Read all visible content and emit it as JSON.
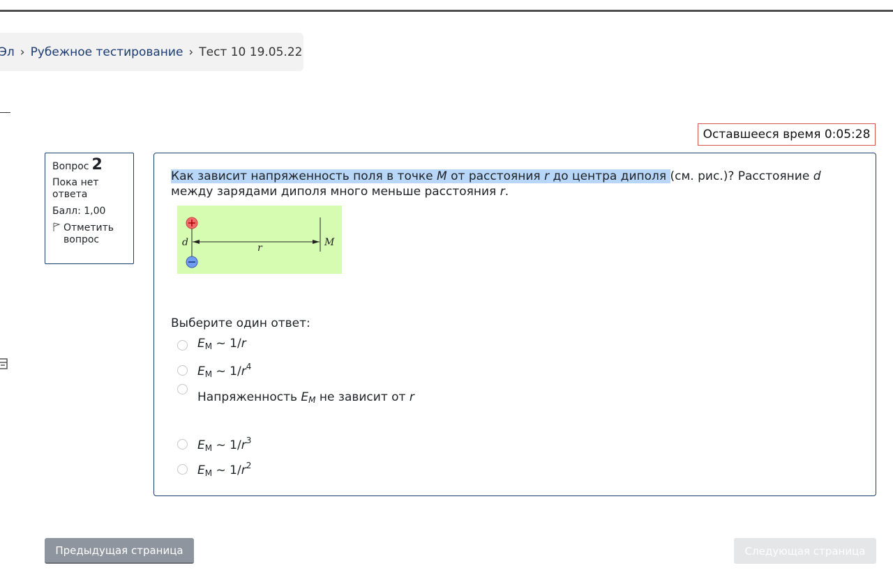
{
  "breadcrumb": {
    "items": [
      "Эл",
      "Рубежное тестирование",
      "Тест 10 19.05.22"
    ]
  },
  "timer": {
    "label": "Оставшееся время",
    "value": "0:05:28"
  },
  "question_info": {
    "label": "Вопрос",
    "number": "2",
    "state": "Пока нет ответа",
    "grade": "Балл: 1,00",
    "flag": "Отметить вопрос"
  },
  "question": {
    "text_part1": "Как зависит напряженность поля в точке ",
    "text_M": "M",
    "text_part2": " от расстояния ",
    "text_r": "r",
    "text_part3": " до центра диполя ",
    "text_part4": "(см. рис.)? Расстояние ",
    "text_d": "d",
    "text_part5": " между зарядами диполя много меньше расстояния ",
    "text_r2": "r",
    "text_end": ".",
    "figure": {
      "d": "d",
      "r": "r",
      "M": "M"
    }
  },
  "prompt": "Выберите один ответ:",
  "answers": [
    {
      "E": "E",
      "sub": "M",
      "rel": " ~ 1/",
      "r": "r",
      "sup": ""
    },
    {
      "E": "E",
      "sub": "M",
      "rel": " ~ 1/",
      "r": "r",
      "sup": "4"
    },
    {
      "pre": "Напряженность ",
      "E": "E",
      "sub": "M",
      "post": " не зависит от ",
      "r": "r"
    },
    {
      "E": "E",
      "sub": "M",
      "rel": " ~ 1/",
      "r": "r",
      "sup": "3"
    },
    {
      "E": "E",
      "sub": "M",
      "rel": " ~ 1/",
      "r": "r",
      "sup": "2"
    }
  ],
  "nav": {
    "prev": "Предыдущая страница",
    "next": "Следующая страница"
  }
}
